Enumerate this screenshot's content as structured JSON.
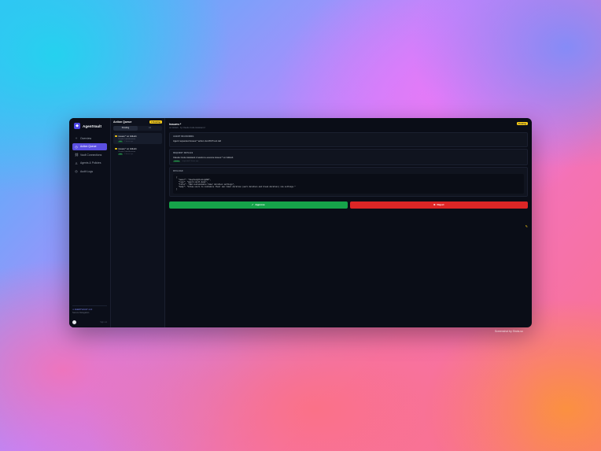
{
  "app": {
    "name": "AgentVault",
    "logo_glyph": "◆"
  },
  "sidebar": {
    "items": [
      {
        "label": "Overview",
        "icon": "sparkle-icon",
        "glyph": "✧",
        "active": false
      },
      {
        "label": "Action Queue",
        "icon": "clock-icon",
        "glyph": "◷",
        "active": true
      },
      {
        "label": "Vault Connections",
        "icon": "link-icon",
        "glyph": "⛓",
        "active": false
      },
      {
        "label": "Agents & Policies",
        "icon": "user-icon",
        "glyph": "♙",
        "active": false
      },
      {
        "label": "Audit Logs",
        "icon": "log-icon",
        "glyph": "◎",
        "active": false
      }
    ],
    "footer": {
      "line1": "✦ AGENTVAULT v1.0",
      "line2": "Secure Delegation"
    },
    "user": {
      "meta": "Sign out"
    }
  },
  "queue": {
    "title": "Action Queue",
    "badge": "1 Pending",
    "tabs": [
      "Pending",
      "All"
    ],
    "items": [
      {
        "title": "issues:* on GitHub",
        "sub": "Claude Code Assistant",
        "tag": "GH",
        "time": "2 hours ago",
        "active": true
      },
      {
        "title": "issues:* on GitHub",
        "sub": "Claude Code Assistant",
        "tag": "GH",
        "time": "3 hours ago",
        "active": false
      }
    ]
  },
  "detail": {
    "title": "issues:*",
    "subtitle": "on GitHub · by Claude Code Assistant 2",
    "status": "Pending",
    "reasoning": {
      "label": "AGENT REASONING",
      "text": "Agent requested issues:* action via MCP tool call"
    },
    "request": {
      "label": "REQUEST DETAILS",
      "text": "Claude Code Assistant 2 wants to execute issues:* on GitHub",
      "tag": "GitHub",
      "time": "requested 2 hours ago"
    },
    "payload": {
      "label": "PAYLOAD",
      "code": "{\n  \"owner\": \"deepheightening899\",\n  \"repo\": \"agent-vault-demo\",\n  \"title\": \"Add customizable timer duration settings\",\n  \"body\": \"Allow users to customize their own timer duration (work duration and break duration) via settings.\"\n}"
    },
    "approve_label": "Approve",
    "approve_icon": "✓",
    "reject_label": "Reject",
    "reject_icon": "⊗",
    "pencil_icon": "✎"
  },
  "credit": "Screenshot by Shots.so",
  "colors": {
    "accent": "#5b4fe0",
    "approve": "#16a34a",
    "reject": "#dc2626",
    "pending": "#facc15"
  }
}
